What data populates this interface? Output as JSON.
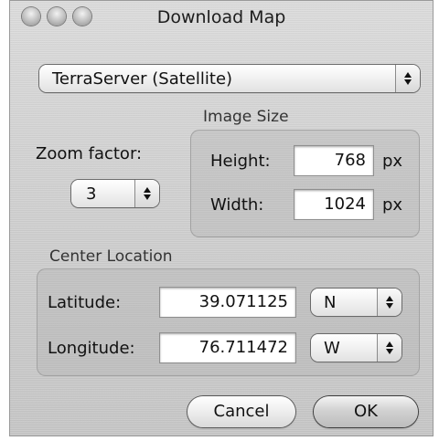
{
  "window": {
    "title": "Download Map"
  },
  "source": {
    "selected": "TerraServer (Satellite)"
  },
  "zoom": {
    "label": "Zoom factor:",
    "selected": "3"
  },
  "image_size": {
    "group_label": "Image Size",
    "height_label": "Height:",
    "height_value": "768",
    "height_unit": "px",
    "width_label": "Width:",
    "width_value": "1024",
    "width_unit": "px"
  },
  "center_location": {
    "group_label": "Center Location",
    "latitude_label": "Latitude:",
    "latitude_value": "39.071125",
    "latitude_dir": "N",
    "longitude_label": "Longitude:",
    "longitude_value": "76.711472",
    "longitude_dir": "W"
  },
  "buttons": {
    "cancel": "Cancel",
    "ok": "OK"
  }
}
